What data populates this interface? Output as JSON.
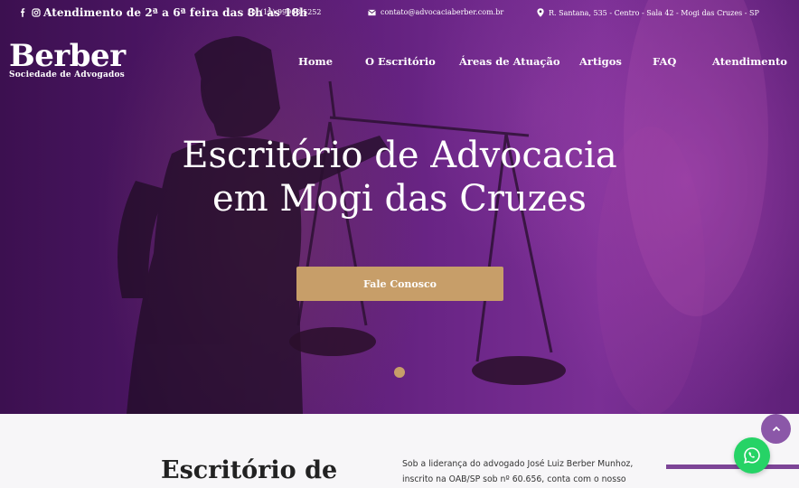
{
  "topbar": {
    "social_icons": [
      "facebook-icon",
      "instagram-icon"
    ],
    "hours": "Atendimento de 2ª a 6ª feira das 8h às 18h",
    "phone": "(11) 99968-5252",
    "email": "contato@advocaciaberber.com.br",
    "address": "R. Santana, 535 - Centro - Sala 42 - Mogi das Cruzes - SP"
  },
  "logo": {
    "main": "Berber",
    "sub": "Sociedade de Advogados"
  },
  "nav": {
    "items": [
      "Home",
      "O Escritório",
      "Áreas de Atuação",
      "Artigos",
      "FAQ",
      "Atendimento"
    ]
  },
  "hero": {
    "title_line1": "Escritório de Advocacia",
    "title_line2": "em Mogi das Cruzes",
    "cta_label": "Fale Conosco",
    "slide_count": 1,
    "active_slide": 1
  },
  "about": {
    "title": "Escritório de",
    "text_line1": "Sob a liderança do advogado José Luiz Berber Munhoz,",
    "text_line2": "inscrito na OAB/SP sob nº 60.656, conta com o nosso"
  },
  "floating": {
    "scroll_top_icon": "chevron-up-icon",
    "whatsapp_icon": "whatsapp-icon"
  },
  "colors": {
    "accent_gold": "#c79e69",
    "accent_purple": "#7d4597",
    "whatsapp_green": "#26d366"
  }
}
